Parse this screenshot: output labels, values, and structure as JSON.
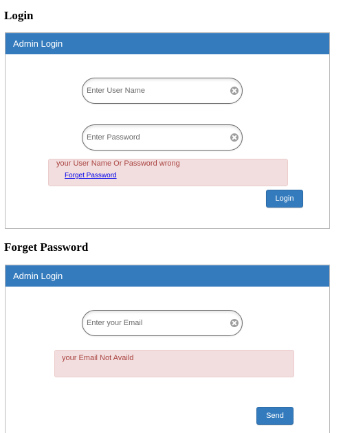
{
  "login_section": {
    "heading": "Login",
    "panel_title": "Admin Login",
    "username": {
      "value": "",
      "placeholder": "Enter User Name"
    },
    "password": {
      "value": "",
      "placeholder": "Enter Password"
    },
    "error": {
      "message": "your User Name Or Password wrong",
      "link_label": "Forget Password"
    },
    "submit_label": "Login"
  },
  "forget_section": {
    "heading": "Forget Password",
    "panel_title": "Admin Login",
    "email": {
      "value": "",
      "placeholder": "Enter your Email"
    },
    "error": {
      "message": "your Email Not Availd"
    },
    "submit_label": "Send"
  },
  "icons": {
    "clear": "clear-circle-x-icon"
  },
  "colors": {
    "header_blue": "#347bbd",
    "alert_background": "#f2dede",
    "alert_text": "#a94442",
    "link": "#0000ee"
  }
}
